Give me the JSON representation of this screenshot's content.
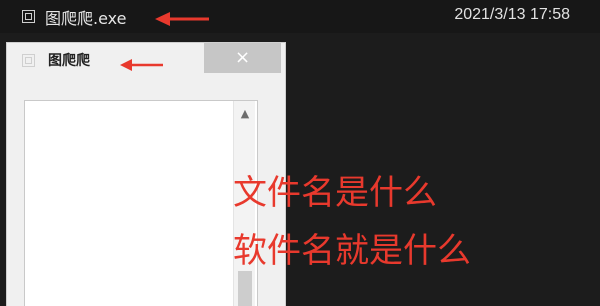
{
  "taskbar": {
    "title": "图爬爬.exe",
    "clock": "2021/3/13 17:58"
  },
  "window": {
    "title": "图爬爬",
    "close_label": "×"
  },
  "scrollbar": {
    "up_arrow": "▲"
  },
  "annotation": {
    "line1": "文件名是什么",
    "line2": "软件名就是什么",
    "color": "#e8392d"
  }
}
